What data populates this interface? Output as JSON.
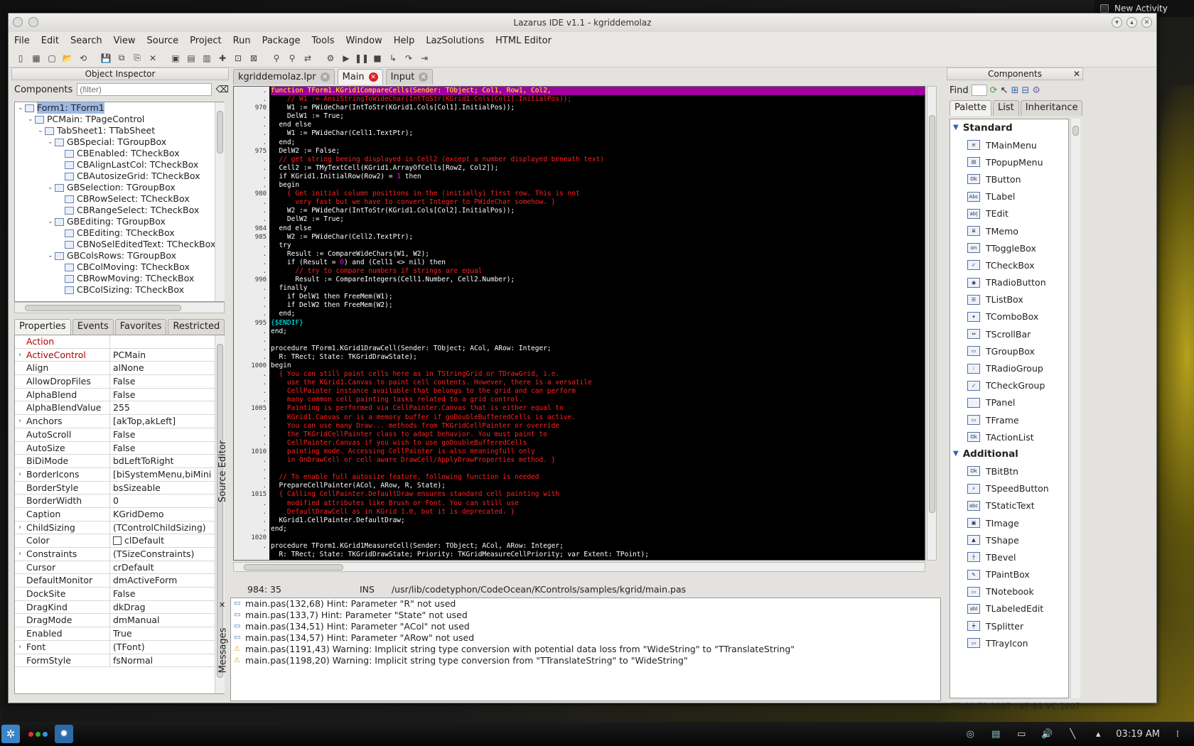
{
  "desktop": {
    "activity_button": "New Activity"
  },
  "window": {
    "title": "Lazarus IDE v1.1 - kgriddemolaz"
  },
  "menu": [
    "File",
    "Edit",
    "Search",
    "View",
    "Source",
    "Project",
    "Run",
    "Package",
    "Tools",
    "Window",
    "Help",
    "LazSolutions",
    "HTML Editor"
  ],
  "toolbar_icons": [
    "new-unit-icon",
    "new-form-icon",
    "new-icon",
    "open-icon",
    "open-recent-icon",
    "save-icon",
    "save-all-icon",
    "save-as-icon",
    "close-icon",
    "toggle-form-icon",
    "view-units-icon",
    "view-forms-icon",
    "new-project-icon",
    "open-project-icon",
    "save-project-icon",
    "inspector-icon",
    "find-icon",
    "replace-icon",
    "build-icon",
    "run-icon",
    "pause-icon",
    "stop-icon",
    "step-into-icon",
    "step-over-icon",
    "run-to-cursor-icon"
  ],
  "object_inspector": {
    "title": "Object Inspector",
    "components_label": "Components",
    "filter_placeholder": "(filter)",
    "tree": [
      {
        "label": "Form1: TForm1",
        "level": 0,
        "expand": "-",
        "selected": true
      },
      {
        "label": "PCMain: TPageControl",
        "level": 1,
        "expand": "-"
      },
      {
        "label": "TabSheet1: TTabSheet",
        "level": 2,
        "expand": "-"
      },
      {
        "label": "GBSpecial: TGroupBox",
        "level": 3,
        "expand": "-"
      },
      {
        "label": "CBEnabled: TCheckBox",
        "level": 4,
        "expand": ""
      },
      {
        "label": "CBAlignLastCol: TCheckBox",
        "level": 4,
        "expand": ""
      },
      {
        "label": "CBAutosizeGrid: TCheckBox",
        "level": 4,
        "expand": ""
      },
      {
        "label": "GBSelection: TGroupBox",
        "level": 3,
        "expand": "-"
      },
      {
        "label": "CBRowSelect: TCheckBox",
        "level": 4,
        "expand": ""
      },
      {
        "label": "CBRangeSelect: TCheckBox",
        "level": 4,
        "expand": ""
      },
      {
        "label": "GBEditing: TGroupBox",
        "level": 3,
        "expand": "-"
      },
      {
        "label": "CBEditing: TCheckBox",
        "level": 4,
        "expand": ""
      },
      {
        "label": "CBNoSelEditedText: TCheckBox",
        "level": 4,
        "expand": ""
      },
      {
        "label": "GBColsRows: TGroupBox",
        "level": 3,
        "expand": "-"
      },
      {
        "label": "CBColMoving: TCheckBox",
        "level": 4,
        "expand": ""
      },
      {
        "label": "CBRowMoving: TCheckBox",
        "level": 4,
        "expand": ""
      },
      {
        "label": "CBColSizing: TCheckBox",
        "level": 4,
        "expand": ""
      }
    ],
    "tabs": [
      "Properties",
      "Events",
      "Favorites",
      "Restricted"
    ],
    "properties": [
      {
        "name": "Action",
        "value": "",
        "expand": "",
        "red": true
      },
      {
        "name": "ActiveControl",
        "value": "PCMain",
        "expand": ">",
        "red": true
      },
      {
        "name": "Align",
        "value": "alNone",
        "expand": ""
      },
      {
        "name": "AllowDropFiles",
        "value": "False",
        "expand": ""
      },
      {
        "name": "AlphaBlend",
        "value": "False",
        "expand": ""
      },
      {
        "name": "AlphaBlendValue",
        "value": "255",
        "expand": ""
      },
      {
        "name": "Anchors",
        "value": "[akTop,akLeft]",
        "expand": ">"
      },
      {
        "name": "AutoScroll",
        "value": "False",
        "expand": ""
      },
      {
        "name": "AutoSize",
        "value": "False",
        "expand": ""
      },
      {
        "name": "BiDiMode",
        "value": "bdLeftToRight",
        "expand": ""
      },
      {
        "name": "BorderIcons",
        "value": "[biSystemMenu,biMini",
        "expand": ">"
      },
      {
        "name": "BorderStyle",
        "value": "bsSizeable",
        "expand": ""
      },
      {
        "name": "BorderWidth",
        "value": "0",
        "expand": ""
      },
      {
        "name": "Caption",
        "value": "KGridDemo",
        "expand": ""
      },
      {
        "name": "ChildSizing",
        "value": "(TControlChildSizing)",
        "expand": ">"
      },
      {
        "name": "Color",
        "value": "clDefault",
        "expand": "",
        "swatch": true
      },
      {
        "name": "Constraints",
        "value": "(TSizeConstraints)",
        "expand": ">"
      },
      {
        "name": "Cursor",
        "value": "crDefault",
        "expand": ""
      },
      {
        "name": "DefaultMonitor",
        "value": "dmActiveForm",
        "expand": ""
      },
      {
        "name": "DockSite",
        "value": "False",
        "expand": ""
      },
      {
        "name": "DragKind",
        "value": "dkDrag",
        "expand": ""
      },
      {
        "name": "DragMode",
        "value": "dmManual",
        "expand": ""
      },
      {
        "name": "Enabled",
        "value": "True",
        "expand": ""
      },
      {
        "name": "Font",
        "value": "(TFont)",
        "expand": ">"
      },
      {
        "name": "FormStyle",
        "value": "fsNormal",
        "expand": ""
      }
    ]
  },
  "source_editor": {
    "side_label": "Source Editor",
    "tabs": [
      {
        "label": "kgriddemolaz.lpr",
        "active": false
      },
      {
        "label": "Main",
        "active": true
      },
      {
        "label": "Input",
        "active": false
      }
    ],
    "gutter": [
      ".",
      ".",
      "970",
      ".",
      ".",
      ".",
      ".",
      "975",
      ".",
      ".",
      ".",
      ".",
      "980",
      ".",
      ".",
      ".",
      "984",
      "985",
      ".",
      ".",
      ".",
      ".",
      "990",
      ".",
      ".",
      ".",
      ".",
      "995",
      ".",
      ".",
      ".",
      ".",
      "1000",
      ".",
      ".",
      ".",
      ".",
      "1005",
      ".",
      ".",
      ".",
      ".",
      "1010",
      ".",
      ".",
      ".",
      ".",
      "1015",
      ".",
      ".",
      ".",
      ".",
      "1020",
      "."
    ],
    "lines": [
      [
        {
          "t": "function TForm1.KGrid1CompareCells(Sender: TObject; Col1, Row1, Col2,",
          "c": "t"
        }
      ],
      [
        {
          "t": "    // W1 := AnsiStringToWideChar(IntToStr(KGrid1.Cols[Col1].InitialPos));",
          "c": "c"
        }
      ],
      [
        {
          "t": "    W1 := PWideChar(IntToStr(KGrid1.Cols[Col1].InitialPos));",
          "c": "k"
        }
      ],
      [
        {
          "t": "    DelW1 := True;",
          "c": "k"
        }
      ],
      [
        {
          "t": "  end else",
          "c": "k"
        }
      ],
      [
        {
          "t": "    W1 := PWideChar(Cell1.TextPtr);",
          "c": "k"
        }
      ],
      [
        {
          "t": "  end;",
          "c": "k"
        }
      ],
      [
        {
          "t": "  DelW2 := False;",
          "c": "k"
        }
      ],
      [
        {
          "t": "  // get string beeing displayed in Cell2 (except a number displayed beneath text)",
          "c": "c"
        }
      ],
      [
        {
          "t": "  Cell2 := TMyTextCell(KGrid1.ArrayOfCells[Row2, Col2]);",
          "c": "k"
        }
      ],
      [
        {
          "t": "  if KGrid1.InitialRow(Row2) = ",
          "c": "k"
        },
        {
          "t": "1",
          "c": "n"
        },
        {
          "t": " then",
          "c": "k"
        }
      ],
      [
        {
          "t": "  begin",
          "c": "k"
        }
      ],
      [
        {
          "t": "    { Get initial column positions in the (initially) first row. This is not",
          "c": "c"
        }
      ],
      [
        {
          "t": "      very fast but we have to convert Integer to PWideChar somehow. }",
          "c": "c"
        }
      ],
      [
        {
          "t": "    W2 := PWideChar(IntToStr(KGrid1.Cols[Col2].InitialPos));",
          "c": "k"
        }
      ],
      [
        {
          "t": "    DelW2 := True;",
          "c": "k"
        }
      ],
      [
        {
          "t": "  end else",
          "c": "k"
        }
      ],
      [
        {
          "t": "    W2 := PWideChar(Cell2.TextPtr);",
          "c": "k"
        }
      ],
      [
        {
          "t": "  try",
          "c": "k"
        }
      ],
      [
        {
          "t": "    Result := CompareWideChars(W1, W2);",
          "c": "k"
        }
      ],
      [
        {
          "t": "    if (Result = ",
          "c": "k"
        },
        {
          "t": "0",
          "c": "n"
        },
        {
          "t": ") and (Cell1 <> nil) then",
          "c": "k"
        }
      ],
      [
        {
          "t": "      // try to compare numbers if strings are equal",
          "c": "c"
        }
      ],
      [
        {
          "t": "      Result := CompareIntegers(Cell1.Number, Cell2.Number);",
          "c": "k"
        }
      ],
      [
        {
          "t": "  finally",
          "c": "k"
        }
      ],
      [
        {
          "t": "    if DelW1 then FreeMem(W1);",
          "c": "k"
        }
      ],
      [
        {
          "t": "    if DelW2 then FreeMem(W2);",
          "c": "k"
        }
      ],
      [
        {
          "t": "  end;",
          "c": "k"
        }
      ],
      [
        {
          "t": "{$ENDIF}",
          "c": "d"
        }
      ],
      [
        {
          "t": "end;",
          "c": "k"
        }
      ],
      [
        {
          "t": "",
          "c": "k"
        }
      ],
      [
        {
          "t": "procedure TForm1.KGrid1DrawCell(Sender: TObject; ACol, ARow: Integer;",
          "c": "k"
        }
      ],
      [
        {
          "t": "  R: TRect; State: TKGridDrawState);",
          "c": "k"
        }
      ],
      [
        {
          "t": "begin",
          "c": "k"
        }
      ],
      [
        {
          "t": "  { You can still paint cells here as in TStringGrid or TDrawGrid, i.e.",
          "c": "c"
        }
      ],
      [
        {
          "t": "    use the KGrid1.Canvas to paint cell contents. However, there is a versatile",
          "c": "c"
        }
      ],
      [
        {
          "t": "    CellPainter instance available that belongs to the grid and can perform",
          "c": "c"
        }
      ],
      [
        {
          "t": "    many common cell painting tasks related to a grid control.",
          "c": "c"
        }
      ],
      [
        {
          "t": "    Painting is performed via CellPainter.Canvas that is either equal to",
          "c": "c"
        }
      ],
      [
        {
          "t": "    KGrid1.Canvas or is a memory buffer if goDoubleBufferedCells is active.",
          "c": "c"
        }
      ],
      [
        {
          "t": "    You can use many Draw... methods from TKGridCellPainter or override",
          "c": "c"
        }
      ],
      [
        {
          "t": "    the TKGridCellPainter class to adapt behavior. You must paint to",
          "c": "c"
        }
      ],
      [
        {
          "t": "    CellPainter.Canvas if you wish to use goDoubleBufferedCells",
          "c": "c"
        }
      ],
      [
        {
          "t": "    painting mode. Accessing CellPainter is also meaningfull only",
          "c": "c"
        }
      ],
      [
        {
          "t": "    in OnDrawCell or cell aware DrawCell/ApplyDrawProperties method. }",
          "c": "c"
        }
      ],
      [
        {
          "t": "",
          "c": "k"
        }
      ],
      [
        {
          "t": "  // To enable full autosize feature, following function is needed",
          "c": "c"
        }
      ],
      [
        {
          "t": "  PrepareCellPainter(ACol, ARow, R, State);",
          "c": "k"
        }
      ],
      [
        {
          "t": "  { Calling CellPainter.DefaultDraw ensures standard cell painting with",
          "c": "c"
        }
      ],
      [
        {
          "t": "    modified attributes like Brush or Font. You can still use",
          "c": "c"
        }
      ],
      [
        {
          "t": "    DefaultDrawCell as in KGrid 1.0, but it is deprecated. }",
          "c": "c"
        }
      ],
      [
        {
          "t": "  KGrid1.CellPainter.DefaultDraw;",
          "c": "k"
        }
      ],
      [
        {
          "t": "end;",
          "c": "k"
        }
      ],
      [
        {
          "t": "",
          "c": "k"
        }
      ],
      [
        {
          "t": "procedure TForm1.KGrid1MeasureCell(Sender: TObject; ACol, ARow: Integer;",
          "c": "k"
        }
      ],
      [
        {
          "t": "  R: TRect; State: TKGridDrawState; Priority: TKGridMeasureCellPriority; var Extent: TPoint);",
          "c": "k"
        }
      ]
    ],
    "status": {
      "position": "984: 35",
      "mode": "INS",
      "path": "/usr/lib/codetyphon/CodeOcean/KControls/samples/kgrid/main.pas"
    }
  },
  "messages": {
    "side_label": "Messages",
    "items": [
      {
        "text": "main.pas(132,68) Hint: Parameter \"R\" not used",
        "type": "hint"
      },
      {
        "text": "main.pas(133,7) Hint: Parameter \"State\" not used",
        "type": "hint"
      },
      {
        "text": "main.pas(134,51) Hint: Parameter \"ACol\" not used",
        "type": "hint"
      },
      {
        "text": "main.pas(134,57) Hint: Parameter \"ARow\" not used",
        "type": "hint"
      },
      {
        "text": "main.pas(1191,43) Warning: Implicit string type conversion with potential data loss from \"WideString\" to \"TTranslateString\"",
        "type": "warning"
      },
      {
        "text": "main.pas(1198,20) Warning: Implicit string type conversion from \"TTranslateString\" to \"WideString\"",
        "type": "warning"
      }
    ]
  },
  "components": {
    "title": "Components",
    "find_label": "Find",
    "tabs": [
      "Palette",
      "List",
      "Inheritance"
    ],
    "categories": [
      {
        "name": "Standard",
        "items": [
          {
            "label": "TMainMenu",
            "icon": "main-menu-icon",
            "glyph": "≡"
          },
          {
            "label": "TPopupMenu",
            "icon": "popup-menu-icon",
            "glyph": "▤"
          },
          {
            "label": "TButton",
            "icon": "button-icon",
            "glyph": "Ok"
          },
          {
            "label": "TLabel",
            "icon": "label-icon",
            "glyph": "Abc"
          },
          {
            "label": "TEdit",
            "icon": "edit-icon",
            "glyph": "ab|"
          },
          {
            "label": "TMemo",
            "icon": "memo-icon",
            "glyph": "≣"
          },
          {
            "label": "TToggleBox",
            "icon": "togglebox-icon",
            "glyph": "on"
          },
          {
            "label": "TCheckBox",
            "icon": "checkbox-icon",
            "glyph": "✓"
          },
          {
            "label": "TRadioButton",
            "icon": "radiobutton-icon",
            "glyph": "◉"
          },
          {
            "label": "TListBox",
            "icon": "listbox-icon",
            "glyph": "☰"
          },
          {
            "label": "TComboBox",
            "icon": "combobox-icon",
            "glyph": "▾"
          },
          {
            "label": "TScrollBar",
            "icon": "scrollbar-icon",
            "glyph": "⇔"
          },
          {
            "label": "TGroupBox",
            "icon": "groupbox-icon",
            "glyph": "▭"
          },
          {
            "label": "TRadioGroup",
            "icon": "radiogroup-icon",
            "glyph": "⁝"
          },
          {
            "label": "TCheckGroup",
            "icon": "checkgroup-icon",
            "glyph": "✓"
          },
          {
            "label": "TPanel",
            "icon": "panel-icon",
            "glyph": ""
          },
          {
            "label": "TFrame",
            "icon": "frame-icon",
            "glyph": "▭"
          },
          {
            "label": "TActionList",
            "icon": "actionlist-icon",
            "glyph": "Ok"
          }
        ]
      },
      {
        "name": "Additional",
        "items": [
          {
            "label": "TBitBtn",
            "icon": "bitbtn-icon",
            "glyph": "Ok"
          },
          {
            "label": "TSpeedButton",
            "icon": "speedbutton-icon",
            "glyph": "⚡"
          },
          {
            "label": "TStaticText",
            "icon": "statictext-icon",
            "glyph": "abc"
          },
          {
            "label": "TImage",
            "icon": "image-icon",
            "glyph": "▣"
          },
          {
            "label": "TShape",
            "icon": "shape-icon",
            "glyph": "▲"
          },
          {
            "label": "TBevel",
            "icon": "bevel-icon",
            "glyph": "┼"
          },
          {
            "label": "TPaintBox",
            "icon": "paintbox-icon",
            "glyph": "✎"
          },
          {
            "label": "TNotebook",
            "icon": "notebook-icon",
            "glyph": "▭"
          },
          {
            "label": "TLabeledEdit",
            "icon": "labelededit-icon",
            "glyph": "abI"
          },
          {
            "label": "TSplitter",
            "icon": "splitter-icon",
            "glyph": "┿"
          },
          {
            "label": "TTrayIcon",
            "icon": "trayicon-icon",
            "glyph": "▭"
          }
        ]
      }
    ],
    "status": "TP:89 TC:1007 - VP:89 VC:1007"
  },
  "taskbar": {
    "clock": "03:19 AM"
  },
  "colors": {
    "code_bg": "#000000",
    "keyword": "#ffffff",
    "comment": "#ff2020",
    "current_line": "#a000a0",
    "directive": "#00ffff"
  }
}
